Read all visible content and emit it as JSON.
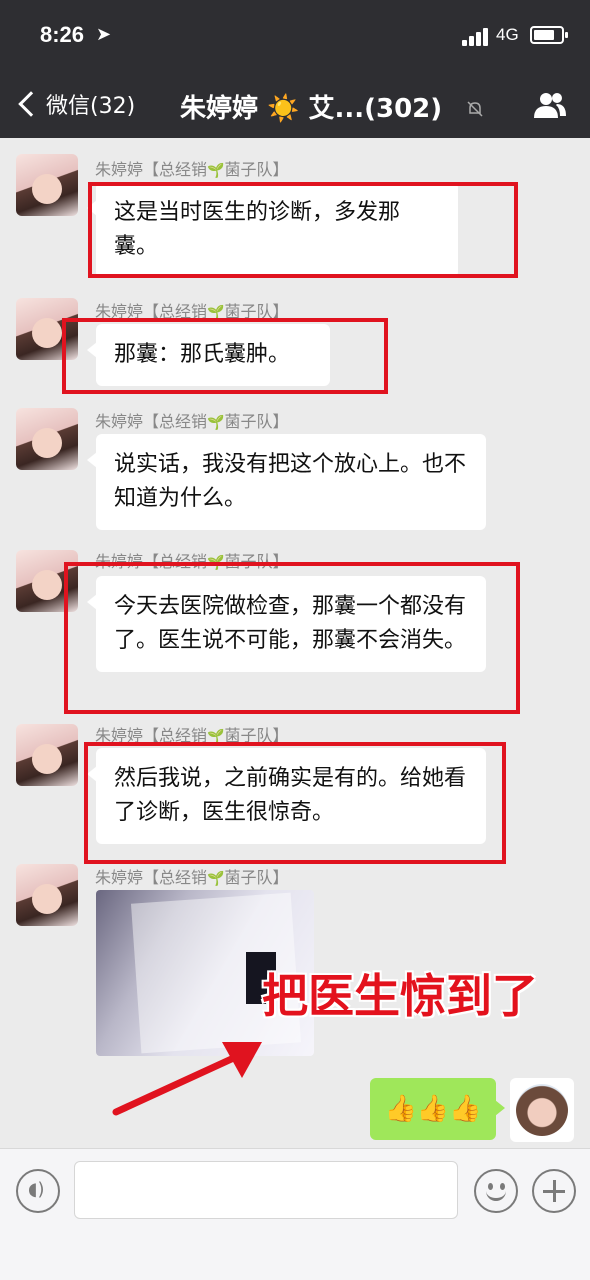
{
  "status_bar": {
    "time": "8:26",
    "location_icon": "location-arrow-icon",
    "network": "4G"
  },
  "nav": {
    "back_label": "微信(32)",
    "title": "朱婷婷 ☀️ 艾...(302)"
  },
  "sender_name": "朱婷婷【总经销",
  "sender_team": "菌子队】",
  "messages": [
    {
      "text": "这是当时医生的诊断，多发那囊。"
    },
    {
      "text": "那囊：那氏囊肿。"
    },
    {
      "text": "说实话，我没有把这个放心上。也不知道为什么。"
    },
    {
      "text": "今天去医院做检查，那囊一个都没有了。医生说不可能，那囊不会消失。"
    },
    {
      "text": "然后我说，之前确实是有的。给她看了诊断，医生很惊奇。"
    }
  ],
  "photo_caption": "把医生惊到了",
  "my_message": "👍👍👍",
  "colors": {
    "nav_bg": "#2e2e32",
    "annotation_red": "#e0131f",
    "my_bubble": "#9fe75a"
  }
}
